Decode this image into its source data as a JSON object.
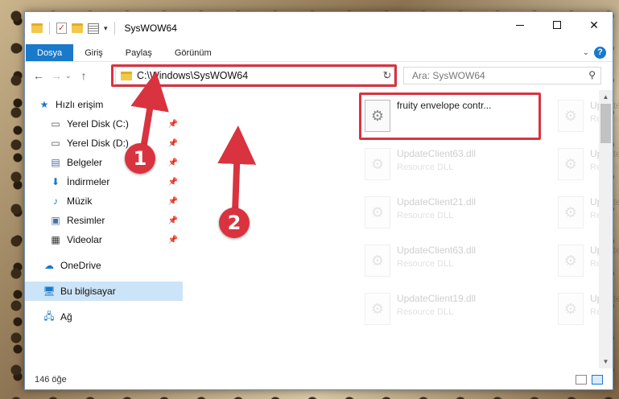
{
  "window": {
    "title": "SysWOW64",
    "controls": {
      "minimize": "—",
      "maximize": "☐",
      "close": "✕"
    }
  },
  "ribbon": {
    "tabs": [
      "Dosya",
      "Giriş",
      "Paylaş",
      "Görünüm"
    ],
    "help": "?"
  },
  "address": {
    "path": "C:\\Windows\\SysWOW64",
    "search_placeholder": "Ara: SysWOW64"
  },
  "sidebar": {
    "items": [
      {
        "label": "Hızlı erişim",
        "icon": "star-icon",
        "pinned": false
      },
      {
        "label": "Yerel Disk (C:)",
        "icon": "drive-icon",
        "pinned": true
      },
      {
        "label": "Yerel Disk (D:)",
        "icon": "drive-icon",
        "pinned": true
      },
      {
        "label": "Belgeler",
        "icon": "documents-icon",
        "pinned": true
      },
      {
        "label": "İndirmeler",
        "icon": "download-icon",
        "pinned": true
      },
      {
        "label": "Müzik",
        "icon": "music-icon",
        "pinned": true
      },
      {
        "label": "Resimler",
        "icon": "pictures-icon",
        "pinned": true
      },
      {
        "label": "Videolar",
        "icon": "videos-icon",
        "pinned": true
      },
      {
        "label": "OneDrive",
        "icon": "cloud-icon",
        "pinned": false
      },
      {
        "label": "Bu bilgisayar",
        "icon": "computer-icon",
        "pinned": false
      },
      {
        "label": "Ağ",
        "icon": "network-icon",
        "pinned": false
      }
    ]
  },
  "files": [
    {
      "name": "fruity envelope contr...",
      "desc": "",
      "selected": true
    },
    {
      "name": "UpdateClient42.dll",
      "desc": "Resource DLL"
    },
    {
      "name": "UpdateClient63.dll",
      "desc": "Resource DLL"
    },
    {
      "name": "UpdateClient21.dll",
      "desc": "Resource DLL"
    },
    {
      "name": "UpdateClient21.dll",
      "desc": "Resource DLL"
    },
    {
      "name": "UpdateClient5.dll",
      "desc": "Resource DLL"
    },
    {
      "name": "UpdateClient63.dll",
      "desc": "Resource DLL"
    },
    {
      "name": "UpdateClient5.dll",
      "desc": "Resource DLL"
    },
    {
      "name": "UpdateClient19.dll",
      "desc": "Resource DLL"
    },
    {
      "name": "UpdateClient63.dll",
      "desc": "Resource DLL"
    }
  ],
  "status": {
    "count": "146 öğe"
  },
  "annotations": {
    "step1": "1",
    "step2": "2"
  },
  "colors": {
    "accent": "#1979ca",
    "highlight": "#d9333f",
    "selected_nav": "#cce4f7"
  }
}
